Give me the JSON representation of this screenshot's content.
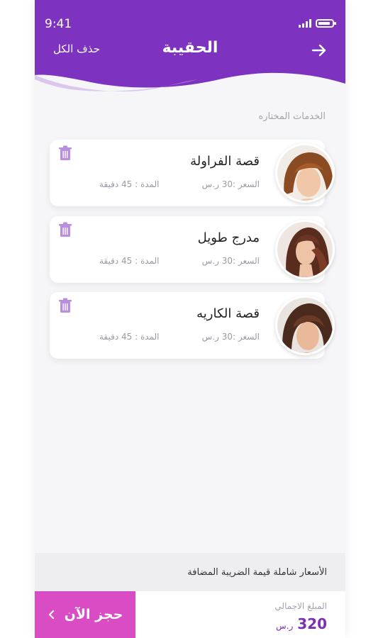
{
  "status_bar": {
    "time": "9:41"
  },
  "header": {
    "title": "الحقيبة",
    "clear_all": "حذف الكل"
  },
  "section_label": "الخدمات المختاره",
  "items": [
    {
      "name": "قصة الفراولة",
      "price": "السعر :30 ر.س",
      "duration": "المدة : 45 دقيقة"
    },
    {
      "name": "مدرج طويل",
      "price": "السعر :30 ر.س",
      "duration": "المدة : 45 دقيقة"
    },
    {
      "name": "قصة الكاريه",
      "price": "السعر :30 ر.س",
      "duration": "المدة : 45 دقيقة"
    }
  ],
  "footer": {
    "tax_note": "الأسعار شاملة قيمة الضريبة المضافة",
    "total_label": "المبلغ الاجمالي",
    "total_value": "320",
    "total_currency": "ر.س",
    "book_label": "حجز الآن"
  },
  "colors": {
    "header_purple": "#7d33c0",
    "accent_pink": "#d94cc4",
    "price_purple": "#7a2fb4"
  },
  "icons": [
    "back-arrow-icon",
    "trash-icon",
    "chevron-left-icon",
    "signal-icon",
    "battery-icon"
  ]
}
